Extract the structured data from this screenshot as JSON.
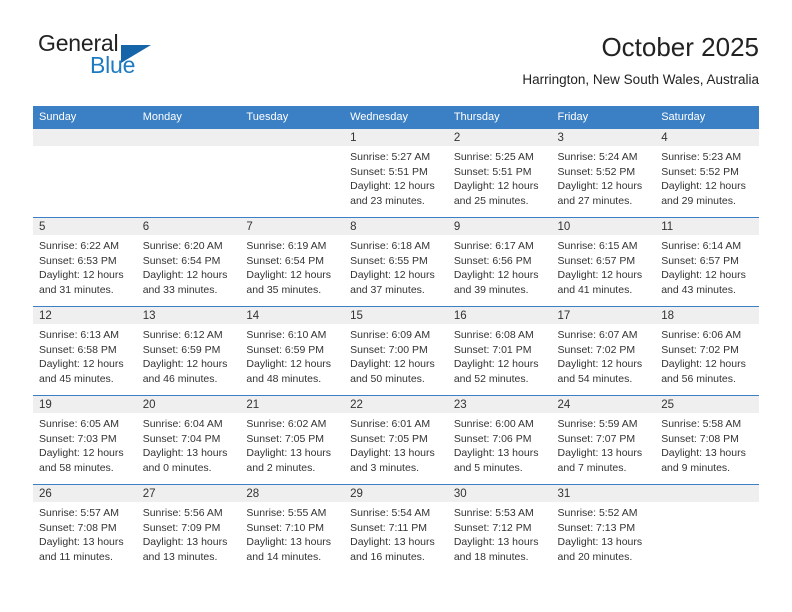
{
  "brand": {
    "name_part1": "General",
    "name_part2": "Blue",
    "accent_color": "#1f7bc1",
    "triangle_color": "#1565a8"
  },
  "header": {
    "title": "October 2025",
    "subtitle": "Harrington, New South Wales, Australia"
  },
  "calendar": {
    "header_bg": "#3b7fc4",
    "daynum_bg": "#efefef",
    "weekday_headers": [
      "Sunday",
      "Monday",
      "Tuesday",
      "Wednesday",
      "Thursday",
      "Friday",
      "Saturday"
    ],
    "weeks": [
      [
        {
          "day": "",
          "empty": true,
          "sunrise": "",
          "sunset": "",
          "daylight_line1": "",
          "daylight_line2": ""
        },
        {
          "day": "",
          "empty": true,
          "sunrise": "",
          "sunset": "",
          "daylight_line1": "",
          "daylight_line2": ""
        },
        {
          "day": "",
          "empty": true,
          "sunrise": "",
          "sunset": "",
          "daylight_line1": "",
          "daylight_line2": ""
        },
        {
          "day": "1",
          "empty": false,
          "sunrise": "Sunrise: 5:27 AM",
          "sunset": "Sunset: 5:51 PM",
          "daylight_line1": "Daylight: 12 hours",
          "daylight_line2": "and 23 minutes."
        },
        {
          "day": "2",
          "empty": false,
          "sunrise": "Sunrise: 5:25 AM",
          "sunset": "Sunset: 5:51 PM",
          "daylight_line1": "Daylight: 12 hours",
          "daylight_line2": "and 25 minutes."
        },
        {
          "day": "3",
          "empty": false,
          "sunrise": "Sunrise: 5:24 AM",
          "sunset": "Sunset: 5:52 PM",
          "daylight_line1": "Daylight: 12 hours",
          "daylight_line2": "and 27 minutes."
        },
        {
          "day": "4",
          "empty": false,
          "sunrise": "Sunrise: 5:23 AM",
          "sunset": "Sunset: 5:52 PM",
          "daylight_line1": "Daylight: 12 hours",
          "daylight_line2": "and 29 minutes."
        }
      ],
      [
        {
          "day": "5",
          "empty": false,
          "sunrise": "Sunrise: 6:22 AM",
          "sunset": "Sunset: 6:53 PM",
          "daylight_line1": "Daylight: 12 hours",
          "daylight_line2": "and 31 minutes."
        },
        {
          "day": "6",
          "empty": false,
          "sunrise": "Sunrise: 6:20 AM",
          "sunset": "Sunset: 6:54 PM",
          "daylight_line1": "Daylight: 12 hours",
          "daylight_line2": "and 33 minutes."
        },
        {
          "day": "7",
          "empty": false,
          "sunrise": "Sunrise: 6:19 AM",
          "sunset": "Sunset: 6:54 PM",
          "daylight_line1": "Daylight: 12 hours",
          "daylight_line2": "and 35 minutes."
        },
        {
          "day": "8",
          "empty": false,
          "sunrise": "Sunrise: 6:18 AM",
          "sunset": "Sunset: 6:55 PM",
          "daylight_line1": "Daylight: 12 hours",
          "daylight_line2": "and 37 minutes."
        },
        {
          "day": "9",
          "empty": false,
          "sunrise": "Sunrise: 6:17 AM",
          "sunset": "Sunset: 6:56 PM",
          "daylight_line1": "Daylight: 12 hours",
          "daylight_line2": "and 39 minutes."
        },
        {
          "day": "10",
          "empty": false,
          "sunrise": "Sunrise: 6:15 AM",
          "sunset": "Sunset: 6:57 PM",
          "daylight_line1": "Daylight: 12 hours",
          "daylight_line2": "and 41 minutes."
        },
        {
          "day": "11",
          "empty": false,
          "sunrise": "Sunrise: 6:14 AM",
          "sunset": "Sunset: 6:57 PM",
          "daylight_line1": "Daylight: 12 hours",
          "daylight_line2": "and 43 minutes."
        }
      ],
      [
        {
          "day": "12",
          "empty": false,
          "sunrise": "Sunrise: 6:13 AM",
          "sunset": "Sunset: 6:58 PM",
          "daylight_line1": "Daylight: 12 hours",
          "daylight_line2": "and 45 minutes."
        },
        {
          "day": "13",
          "empty": false,
          "sunrise": "Sunrise: 6:12 AM",
          "sunset": "Sunset: 6:59 PM",
          "daylight_line1": "Daylight: 12 hours",
          "daylight_line2": "and 46 minutes."
        },
        {
          "day": "14",
          "empty": false,
          "sunrise": "Sunrise: 6:10 AM",
          "sunset": "Sunset: 6:59 PM",
          "daylight_line1": "Daylight: 12 hours",
          "daylight_line2": "and 48 minutes."
        },
        {
          "day": "15",
          "empty": false,
          "sunrise": "Sunrise: 6:09 AM",
          "sunset": "Sunset: 7:00 PM",
          "daylight_line1": "Daylight: 12 hours",
          "daylight_line2": "and 50 minutes."
        },
        {
          "day": "16",
          "empty": false,
          "sunrise": "Sunrise: 6:08 AM",
          "sunset": "Sunset: 7:01 PM",
          "daylight_line1": "Daylight: 12 hours",
          "daylight_line2": "and 52 minutes."
        },
        {
          "day": "17",
          "empty": false,
          "sunrise": "Sunrise: 6:07 AM",
          "sunset": "Sunset: 7:02 PM",
          "daylight_line1": "Daylight: 12 hours",
          "daylight_line2": "and 54 minutes."
        },
        {
          "day": "18",
          "empty": false,
          "sunrise": "Sunrise: 6:06 AM",
          "sunset": "Sunset: 7:02 PM",
          "daylight_line1": "Daylight: 12 hours",
          "daylight_line2": "and 56 minutes."
        }
      ],
      [
        {
          "day": "19",
          "empty": false,
          "sunrise": "Sunrise: 6:05 AM",
          "sunset": "Sunset: 7:03 PM",
          "daylight_line1": "Daylight: 12 hours",
          "daylight_line2": "and 58 minutes."
        },
        {
          "day": "20",
          "empty": false,
          "sunrise": "Sunrise: 6:04 AM",
          "sunset": "Sunset: 7:04 PM",
          "daylight_line1": "Daylight: 13 hours",
          "daylight_line2": "and 0 minutes."
        },
        {
          "day": "21",
          "empty": false,
          "sunrise": "Sunrise: 6:02 AM",
          "sunset": "Sunset: 7:05 PM",
          "daylight_line1": "Daylight: 13 hours",
          "daylight_line2": "and 2 minutes."
        },
        {
          "day": "22",
          "empty": false,
          "sunrise": "Sunrise: 6:01 AM",
          "sunset": "Sunset: 7:05 PM",
          "daylight_line1": "Daylight: 13 hours",
          "daylight_line2": "and 3 minutes."
        },
        {
          "day": "23",
          "empty": false,
          "sunrise": "Sunrise: 6:00 AM",
          "sunset": "Sunset: 7:06 PM",
          "daylight_line1": "Daylight: 13 hours",
          "daylight_line2": "and 5 minutes."
        },
        {
          "day": "24",
          "empty": false,
          "sunrise": "Sunrise: 5:59 AM",
          "sunset": "Sunset: 7:07 PM",
          "daylight_line1": "Daylight: 13 hours",
          "daylight_line2": "and 7 minutes."
        },
        {
          "day": "25",
          "empty": false,
          "sunrise": "Sunrise: 5:58 AM",
          "sunset": "Sunset: 7:08 PM",
          "daylight_line1": "Daylight: 13 hours",
          "daylight_line2": "and 9 minutes."
        }
      ],
      [
        {
          "day": "26",
          "empty": false,
          "sunrise": "Sunrise: 5:57 AM",
          "sunset": "Sunset: 7:08 PM",
          "daylight_line1": "Daylight: 13 hours",
          "daylight_line2": "and 11 minutes."
        },
        {
          "day": "27",
          "empty": false,
          "sunrise": "Sunrise: 5:56 AM",
          "sunset": "Sunset: 7:09 PM",
          "daylight_line1": "Daylight: 13 hours",
          "daylight_line2": "and 13 minutes."
        },
        {
          "day": "28",
          "empty": false,
          "sunrise": "Sunrise: 5:55 AM",
          "sunset": "Sunset: 7:10 PM",
          "daylight_line1": "Daylight: 13 hours",
          "daylight_line2": "and 14 minutes."
        },
        {
          "day": "29",
          "empty": false,
          "sunrise": "Sunrise: 5:54 AM",
          "sunset": "Sunset: 7:11 PM",
          "daylight_line1": "Daylight: 13 hours",
          "daylight_line2": "and 16 minutes."
        },
        {
          "day": "30",
          "empty": false,
          "sunrise": "Sunrise: 5:53 AM",
          "sunset": "Sunset: 7:12 PM",
          "daylight_line1": "Daylight: 13 hours",
          "daylight_line2": "and 18 minutes."
        },
        {
          "day": "31",
          "empty": false,
          "sunrise": "Sunrise: 5:52 AM",
          "sunset": "Sunset: 7:13 PM",
          "daylight_line1": "Daylight: 13 hours",
          "daylight_line2": "and 20 minutes."
        },
        {
          "day": "",
          "empty": true,
          "sunrise": "",
          "sunset": "",
          "daylight_line1": "",
          "daylight_line2": ""
        }
      ]
    ]
  }
}
